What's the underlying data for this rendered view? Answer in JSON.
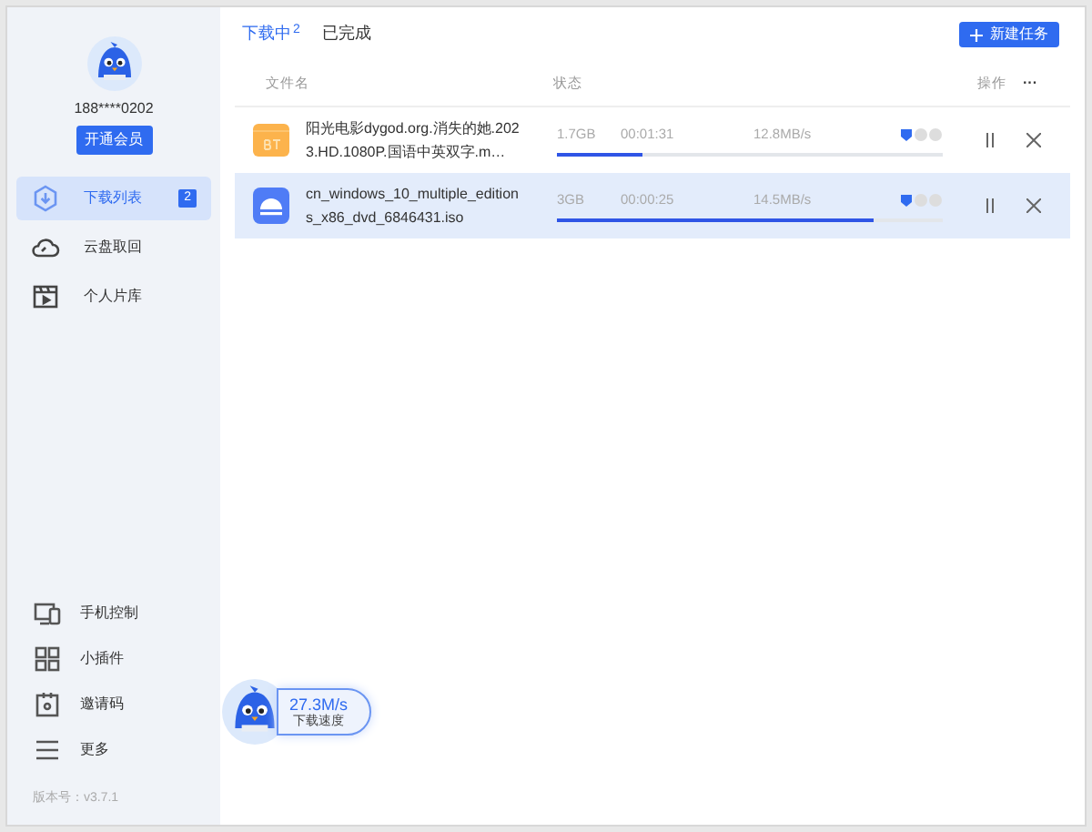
{
  "user": {
    "phone": "188****0202",
    "vip_button": "开通会员"
  },
  "nav": [
    {
      "label": "下载列表",
      "badge": "2",
      "selected": true,
      "kind": "download"
    },
    {
      "label": "云盘取回",
      "selected": false,
      "kind": "cloud"
    },
    {
      "label": "个人片库",
      "selected": false,
      "kind": "library"
    }
  ],
  "bottom_nav": [
    {
      "label": "手机控制",
      "kind": "devices"
    },
    {
      "label": "小插件",
      "kind": "grid"
    },
    {
      "label": "邀请码",
      "kind": "invite"
    },
    {
      "label": "更多",
      "kind": "menu"
    }
  ],
  "version": "版本号：v3.7.1",
  "tabs": [
    {
      "label": "下载中",
      "count": "2",
      "selected": true
    },
    {
      "label": "已完成",
      "selected": false
    }
  ],
  "new_task_button": "新建任务",
  "columns": {
    "name": "文件名",
    "status": "状态",
    "actions": "操作",
    "more": "···"
  },
  "rows": [
    {
      "kind": "bt",
      "name": "阳光电影dygod.org.消失的她.2023.HD.1080P.国语中英双字.m…",
      "size": "1.7GB",
      "time": "00:01:31",
      "speed": "12.8MB/s",
      "level": 0.22,
      "selected": false
    },
    {
      "kind": "disc",
      "name": "cn_windows_10_multiple_editions_x86_dvd_6846431.iso",
      "size": "3GB",
      "time": "00:00:25",
      "speed": "14.5MB/s",
      "level": 0.82,
      "selected": true
    }
  ],
  "speed_widget": {
    "speed": "27.3M/s",
    "label": "下载速度"
  }
}
